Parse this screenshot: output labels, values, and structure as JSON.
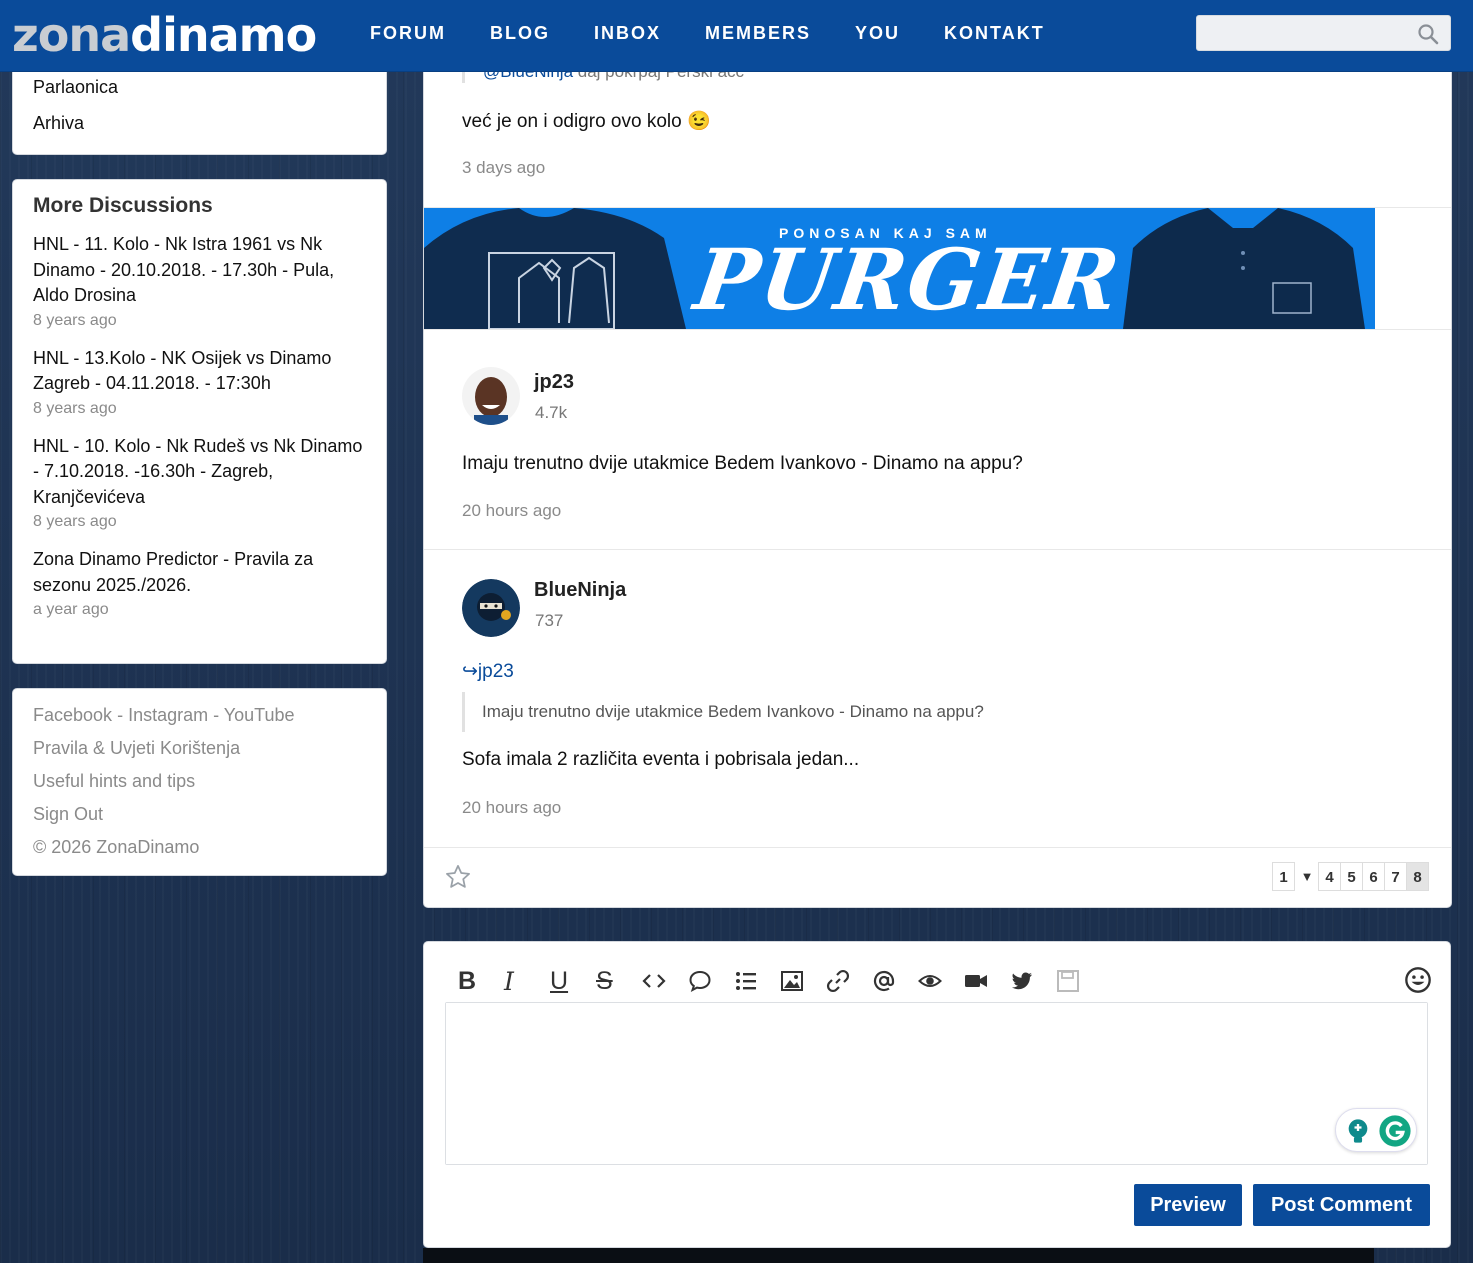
{
  "header": {
    "logo_part1": "zona",
    "logo_part2": "dinamo",
    "nav": [
      "FORUM",
      "BLOG",
      "INBOX",
      "MEMBERS",
      "YOU",
      "KONTAKT"
    ],
    "search_placeholder": ""
  },
  "sidebar": {
    "categories": [
      "Parlaonica",
      "Arhiva"
    ],
    "more_title": "More Discussions",
    "discussions": [
      {
        "title": "HNL - 11. Kolo - Nk Istra 1961 vs Nk Dinamo - 20.10.2018. - 17.30h - Pula, Aldo Drosina",
        "age": "8 years ago"
      },
      {
        "title": "HNL - 13.Kolo - NK Osijek vs Dinamo Zagreb - 04.11.2018. - 17:30h",
        "age": "8 years ago"
      },
      {
        "title": "HNL - 10. Kolo - Nk Rudeš vs Nk Dinamo - 7.10.2018. -16.30h - Zagreb, Kranjčevićeva",
        "age": "8 years ago"
      },
      {
        "title": "Zona Dinamo Predictor - Pravila za sezonu 2025./2026.",
        "age": "a year ago"
      }
    ],
    "footer": {
      "facebook": "Facebook",
      "instagram": "Instagram",
      "youtube": "YouTube",
      "separator": " - ",
      "rules": "Pravila & Uvjeti Korištenja",
      "hints": "Useful hints and tips",
      "signout": "Sign Out",
      "copyright": "© 2026 ZonaDinamo"
    }
  },
  "thread": {
    "partial_post": {
      "quote_mention": "@BlueNinja",
      "quote_text": " daj pokrpaj Perski acc",
      "body": "već je on i odigro ovo kolo",
      "emoji": "😉",
      "time": "3 days ago"
    },
    "banner": {
      "subtitle": "PONOSAN KAJ SAM",
      "title": "PURGER"
    },
    "posts": [
      {
        "user": "jp23",
        "count": "4.7k",
        "body": "Imaju trenutno dvije utakmice Bedem Ivankovo - Dinamo na appu?",
        "time": "20 hours ago"
      },
      {
        "user": "BlueNinja",
        "count": "737",
        "reply_to": "jp23",
        "quote": "Imaju trenutno dvije utakmice Bedem Ivankovo - Dinamo na appu?",
        "body": "Sofa imala 2 različita eventa i pobrisala jedan...",
        "time": "20 hours ago"
      }
    ],
    "pager": {
      "first": "1",
      "gap": "▼",
      "pages": [
        "4",
        "5",
        "6",
        "7",
        "8"
      ],
      "current": "8"
    }
  },
  "composer": {
    "bold": "B",
    "italic": "I",
    "underline": "U",
    "strike": "S",
    "preview_label": "Preview",
    "post_label": "Post Comment"
  },
  "colors": {
    "brand": "#0a4b9a",
    "banner": "#0e7fe6"
  }
}
